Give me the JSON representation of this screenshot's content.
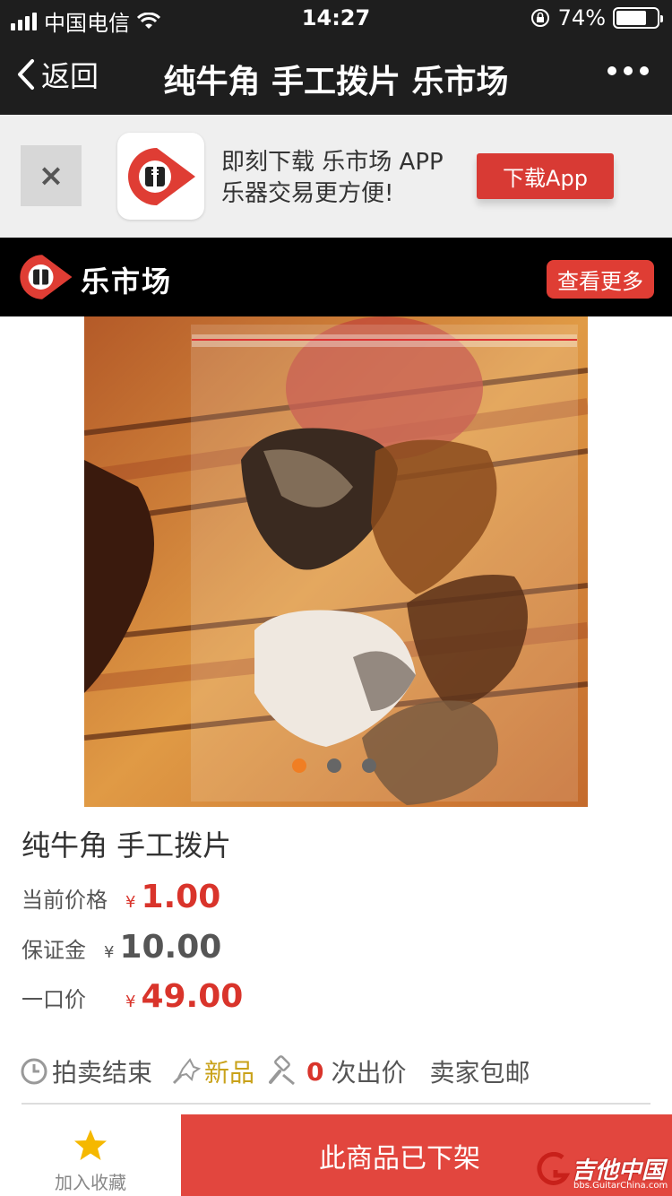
{
  "status": {
    "carrier": "中国电信",
    "time": "14:27",
    "battery": "74%",
    "battery_level": 0.74
  },
  "nav": {
    "back": "返回",
    "title": "纯牛角 手工拨片 乐市场"
  },
  "banner": {
    "line1": "即刻下载 乐市场 APP",
    "line2": "乐器交易更方便!",
    "download": "下载App",
    "close": "×"
  },
  "brand": {
    "name": "乐市场",
    "more": "查看更多"
  },
  "carousel": {
    "count": 3,
    "active_index": 0
  },
  "product": {
    "title": "纯牛角 手工拨片",
    "current_price_label": "当前价格",
    "current_price": "1.00",
    "deposit_label": "保证金",
    "deposit": "10.00",
    "buyout_label": "一口价",
    "buyout": "49.00",
    "currency": "¥"
  },
  "meta": {
    "auction": "拍卖结束",
    "condition": "新品",
    "bids": "0",
    "bids_suffix": "次出价",
    "shipping": "卖家包邮"
  },
  "bottom": {
    "favorite": "加入收藏",
    "status": "此商品已下架"
  },
  "watermark": {
    "big": "吉他中国",
    "small": "bbs.GuitarChina.com"
  },
  "colors": {
    "accent": "#d9342b",
    "dark": "#1e1e1e",
    "gold": "#c9a21a"
  }
}
